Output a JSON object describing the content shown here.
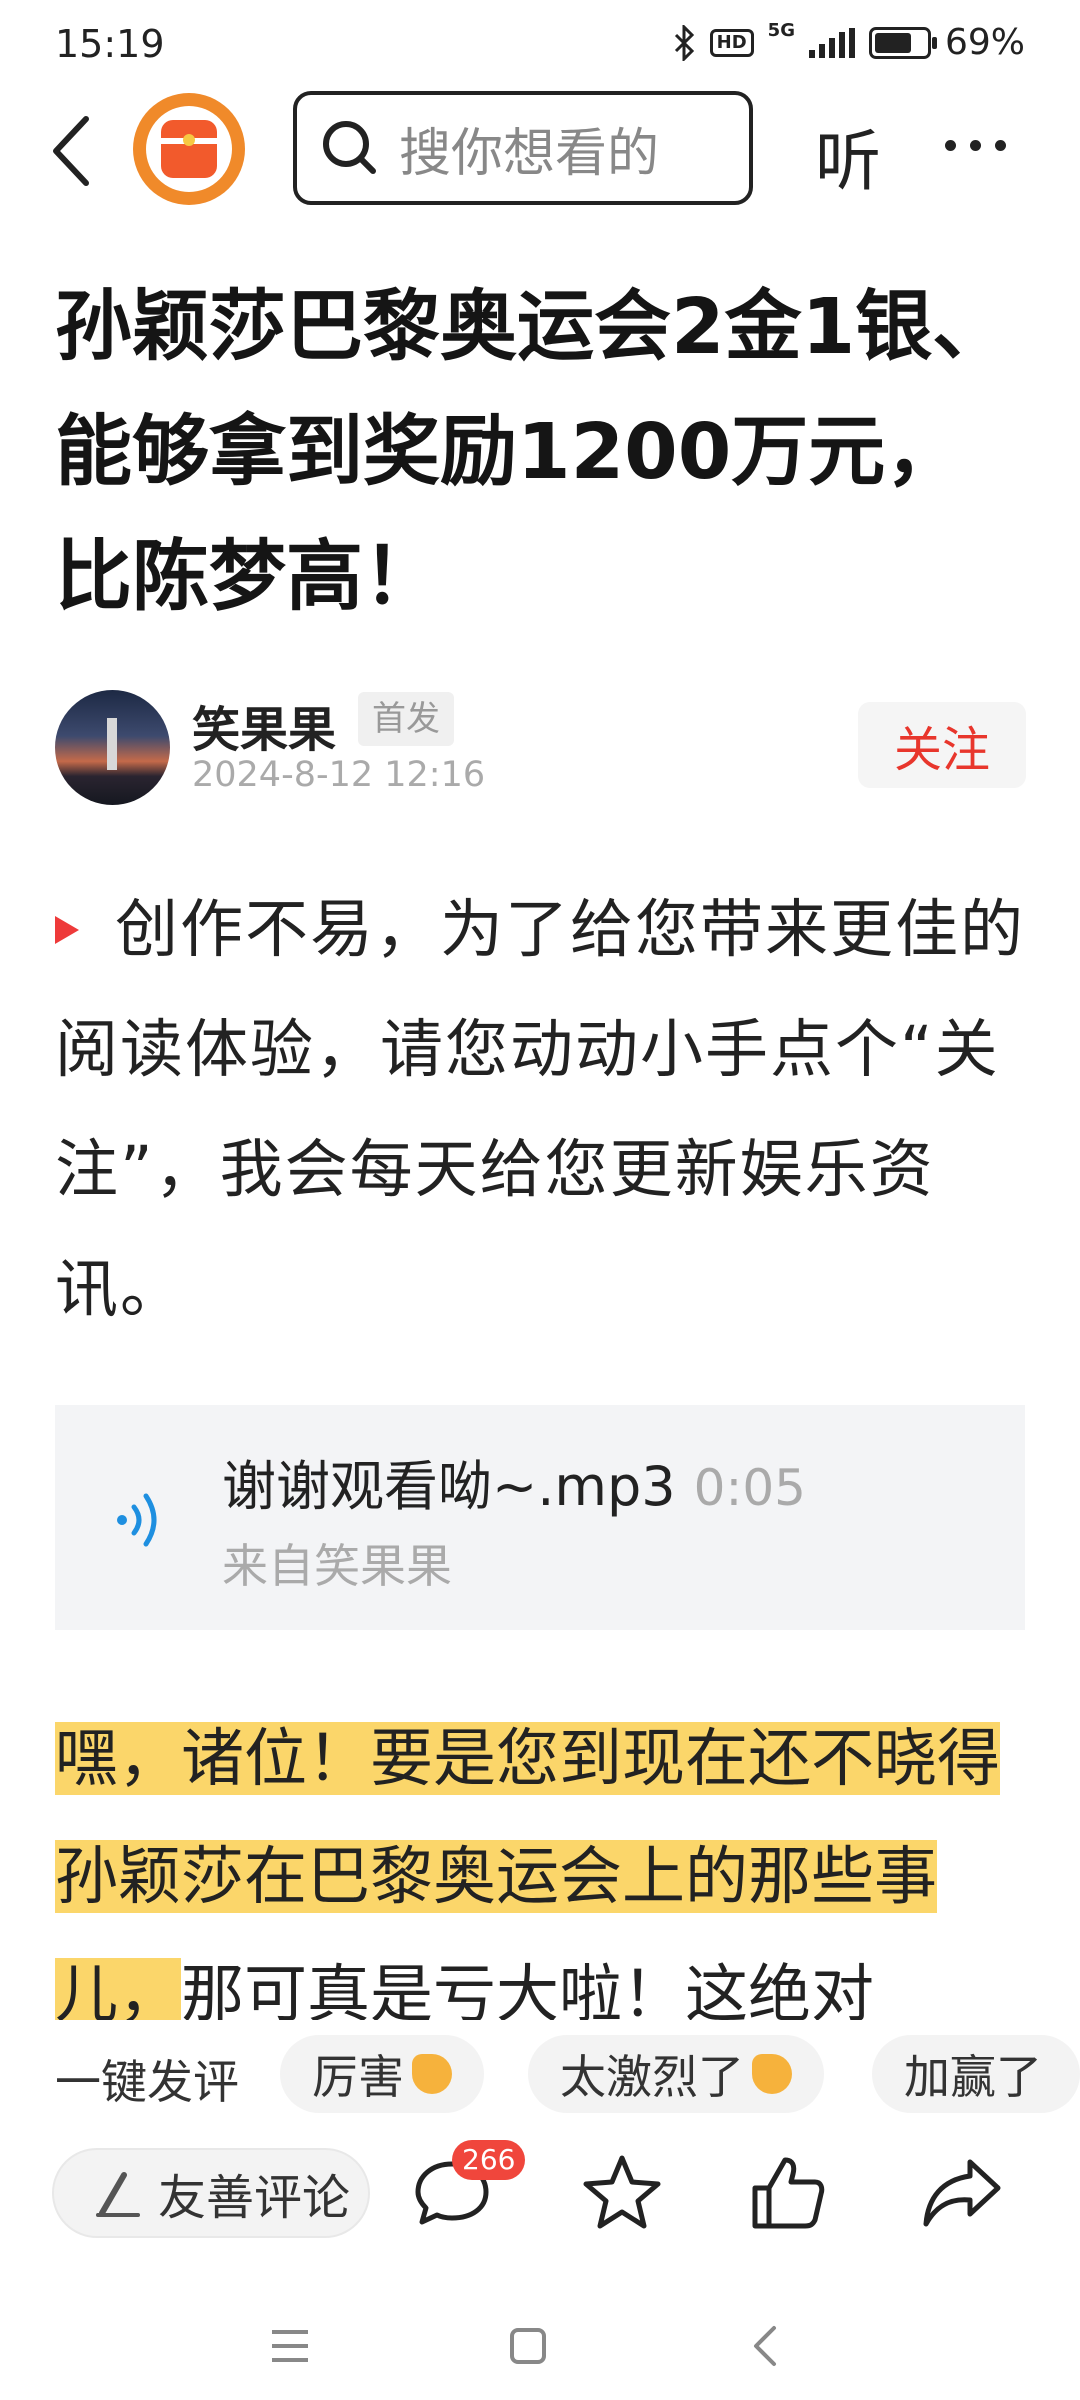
{
  "status_bar": {
    "time": "15:19",
    "network": "5G",
    "battery": "69%"
  },
  "header": {
    "search_placeholder": "搜你想看的",
    "listen_label": "听"
  },
  "article": {
    "title": "孙颖莎巴黎奥运会2金1银、能够拿到奖励1200万元，比陈梦高！",
    "author": "笑果果",
    "badge": "首发",
    "date": "2024-8-12  12:16",
    "follow_label": "关注",
    "intro": "创作不易，为了给您带来更佳的阅读体验，请您动动小手点个“关注”，我会每天给您更新娱乐资讯。",
    "audio": {
      "title": "谢谢观看呦~.mp3",
      "duration": "0:05",
      "source": "来自笑果果"
    },
    "body_highlight": "嘿，诸位！要是您到现在还不晓得孙颖莎在巴黎奥运会上的那些事儿，",
    "body_rest": "那可真是亏大啦！这绝对"
  },
  "quick_comment": {
    "label": "一键发评",
    "chips": [
      "厉害",
      "太激烈了",
      "加赢了"
    ]
  },
  "action_bar": {
    "comment_placeholder": "友善评论",
    "comment_count": "266"
  },
  "colors": {
    "accent_red": "#e8362c",
    "highlight": "#fbd66a",
    "audio_blue": "#1e8fe0"
  }
}
